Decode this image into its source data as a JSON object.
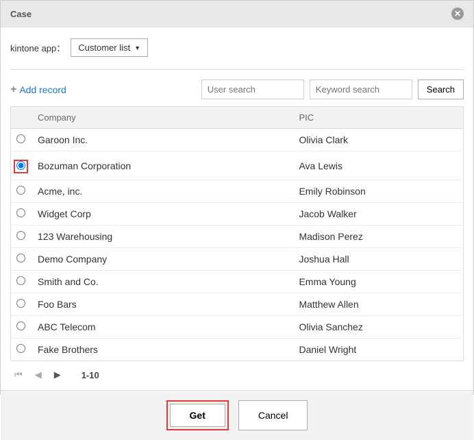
{
  "dialog": {
    "title": "Case"
  },
  "app": {
    "label": "kintone app：",
    "selected": "Customer list"
  },
  "toolbar": {
    "add_record": "Add record",
    "user_search_placeholder": "User search",
    "keyword_search_placeholder": "Keyword search",
    "search_button": "Search"
  },
  "table": {
    "headers": {
      "company": "Company",
      "pic": "PIC"
    },
    "rows": [
      {
        "company": "Garoon Inc.",
        "pic": "Olivia Clark",
        "selected": false
      },
      {
        "company": "Bozuman Corporation",
        "pic": "Ava Lewis",
        "selected": true
      },
      {
        "company": "Acme, inc.",
        "pic": "Emily Robinson",
        "selected": false
      },
      {
        "company": "Widget Corp",
        "pic": "Jacob Walker",
        "selected": false
      },
      {
        "company": "123 Warehousing",
        "pic": "Madison Perez",
        "selected": false
      },
      {
        "company": "Demo Company",
        "pic": "Joshua Hall",
        "selected": false
      },
      {
        "company": "Smith and Co.",
        "pic": "Emma Young",
        "selected": false
      },
      {
        "company": "Foo Bars",
        "pic": "Matthew Allen",
        "selected": false
      },
      {
        "company": "ABC Telecom",
        "pic": "Olivia Sanchez",
        "selected": false
      },
      {
        "company": "Fake Brothers",
        "pic": "Daniel Wright",
        "selected": false
      }
    ]
  },
  "pager": {
    "info": "1-10"
  },
  "footer": {
    "get": "Get",
    "cancel": "Cancel"
  }
}
